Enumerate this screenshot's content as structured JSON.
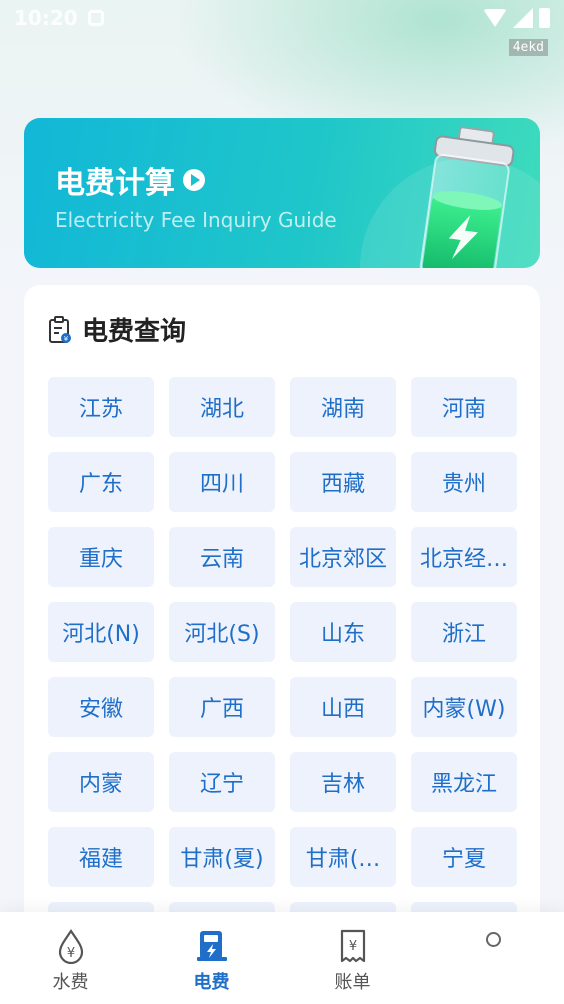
{
  "status": {
    "time": "10:20",
    "tag": "4ekd"
  },
  "banner": {
    "title": "电费计算",
    "subtitle": "Electricity Fee Inquiry Guide"
  },
  "section": {
    "title": "电费查询",
    "regions": [
      "江苏",
      "湖北",
      "湖南",
      "河南",
      "广东",
      "四川",
      "西藏",
      "贵州",
      "重庆",
      "云南",
      "北京郊区",
      "北京经…",
      "河北(N)",
      "河北(S)",
      "山东",
      "浙江",
      "安徽",
      "广西",
      "山西",
      "内蒙(W)",
      "内蒙",
      "辽宁",
      "吉林",
      "黑龙江",
      "福建",
      "甘肃(夏)",
      "甘肃(…",
      "宁夏"
    ]
  },
  "tabs": [
    {
      "label": "水费",
      "icon": "water-fee-icon"
    },
    {
      "label": "电费",
      "icon": "electric-fee-icon",
      "active": true
    },
    {
      "label": "账单",
      "icon": "bill-icon"
    },
    {
      "label": "",
      "icon": "mine-icon"
    }
  ],
  "colors": {
    "accent": "#1f6fc9",
    "banner_start": "#12b7d7",
    "banner_end": "#3fdcbc",
    "cell_bg": "#edf2fc"
  }
}
